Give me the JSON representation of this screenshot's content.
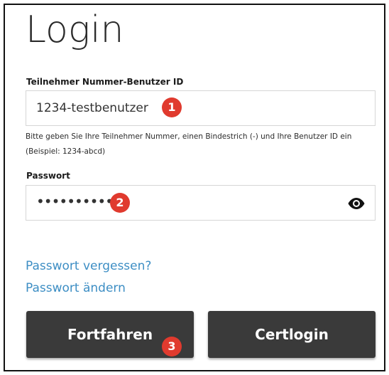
{
  "page": {
    "title": "Login"
  },
  "user_id_field": {
    "label": "Teilnehmer Nummer-Benutzer ID",
    "value": "1234-testbenutzer",
    "hint": "Bitte geben Sie Ihre Teilnehmer Nummer, einen Bindestrich (-) und Ihre Benutzer ID ein (Beispiel: 1234-abcd)"
  },
  "password_field": {
    "label": "Passwort",
    "value_masked": "•••••••••••",
    "toggle_icon": "eye-icon"
  },
  "links": {
    "forgot_password": "Passwort vergessen?",
    "change_password": "Passwort ändern"
  },
  "buttons": {
    "continue_label": "Fortfahren",
    "certlogin_label": "Certlogin"
  },
  "annotations": {
    "step_1": "1",
    "step_2": "2",
    "step_3": "3"
  },
  "colors": {
    "link": "#3d8ec4",
    "button_bg": "#3a3a3a",
    "badge": "#e03a2e"
  }
}
